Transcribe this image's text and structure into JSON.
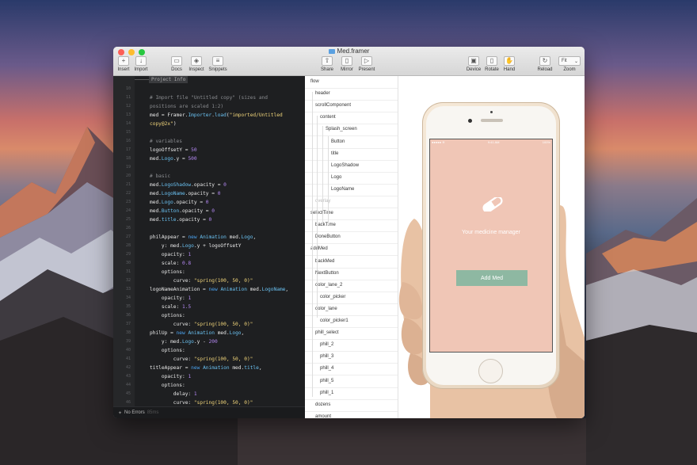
{
  "window": {
    "title": "Med.framer",
    "traffic_lights": {
      "close": "#fc5f57",
      "minimize": "#fdbc2e",
      "zoom": "#28c840"
    }
  },
  "toolbar": {
    "insert": "Insert",
    "import": "Import",
    "docs": "Docs",
    "inspect": "Inspect",
    "snippets": "Snippets",
    "share": "Share",
    "mirror": "Mirror",
    "present": "Present",
    "device": "Device",
    "rotate": "Rotate",
    "hand": "Hand",
    "reload": "Reload",
    "zoom": "Zoom",
    "zoom_value": "Fit"
  },
  "editor": {
    "tag": "Project Info",
    "line_numbers": [
      "10",
      "11",
      "12",
      "13",
      "14",
      "15",
      "16",
      "17",
      "18",
      "19",
      "20",
      "21",
      "22",
      "23",
      "24",
      "25",
      "26",
      "27",
      "28",
      "29",
      "30",
      "31",
      "32",
      "33",
      "34",
      "35",
      "36",
      "37",
      "38",
      "39",
      "40",
      "41",
      "42",
      "43",
      "44",
      "45",
      "46"
    ],
    "status_text": "No Errors",
    "status_time": "85ms"
  },
  "layers": [
    {
      "name": "flow",
      "indent": 0,
      "dim": false
    },
    {
      "name": "header",
      "indent": 1,
      "dim": false
    },
    {
      "name": "scrollComponent",
      "indent": 1,
      "dim": false
    },
    {
      "name": "content",
      "indent": 2,
      "dim": false
    },
    {
      "name": "Splash_screen",
      "indent": 3,
      "dim": false
    },
    {
      "name": "Button",
      "indent": 4,
      "dim": false
    },
    {
      "name": "title",
      "indent": 4,
      "dim": false
    },
    {
      "name": "LogoShadow",
      "indent": 4,
      "dim": false
    },
    {
      "name": "Logo",
      "indent": 4,
      "dim": false
    },
    {
      "name": "LogoName",
      "indent": 4,
      "dim": false
    },
    {
      "name": "overlay",
      "indent": 1,
      "dim": true
    },
    {
      "name": "selectTime",
      "indent": 0,
      "dim": false
    },
    {
      "name": "backTime",
      "indent": 1,
      "dim": false
    },
    {
      "name": "DoneButton",
      "indent": 1,
      "dim": false
    },
    {
      "name": "addMed",
      "indent": 0,
      "dim": false
    },
    {
      "name": "backMed",
      "indent": 1,
      "dim": false
    },
    {
      "name": "NextButton",
      "indent": 1,
      "dim": false
    },
    {
      "name": "color_lane_2",
      "indent": 1,
      "dim": false
    },
    {
      "name": "color_picker",
      "indent": 2,
      "dim": false
    },
    {
      "name": "color_lane",
      "indent": 1,
      "dim": false
    },
    {
      "name": "color_picker1",
      "indent": 2,
      "dim": false
    },
    {
      "name": "phill_select",
      "indent": 1,
      "dim": false
    },
    {
      "name": "phill_2",
      "indent": 2,
      "dim": false
    },
    {
      "name": "phill_3",
      "indent": 2,
      "dim": false
    },
    {
      "name": "phill_4",
      "indent": 2,
      "dim": false
    },
    {
      "name": "phill_5",
      "indent": 2,
      "dim": false
    },
    {
      "name": "phill_1",
      "indent": 2,
      "dim": false
    },
    {
      "name": "dozens",
      "indent": 1,
      "dim": false
    },
    {
      "name": "amount",
      "indent": 1,
      "dim": false
    }
  ],
  "preview": {
    "tagline": "Your medicine manager",
    "button": "Add Med",
    "carrier": "●●●●● ≋",
    "clock": "9:41 AM",
    "battery": "100%",
    "screen_color": "#f0c6b6",
    "button_color": "#8eb8a2"
  }
}
